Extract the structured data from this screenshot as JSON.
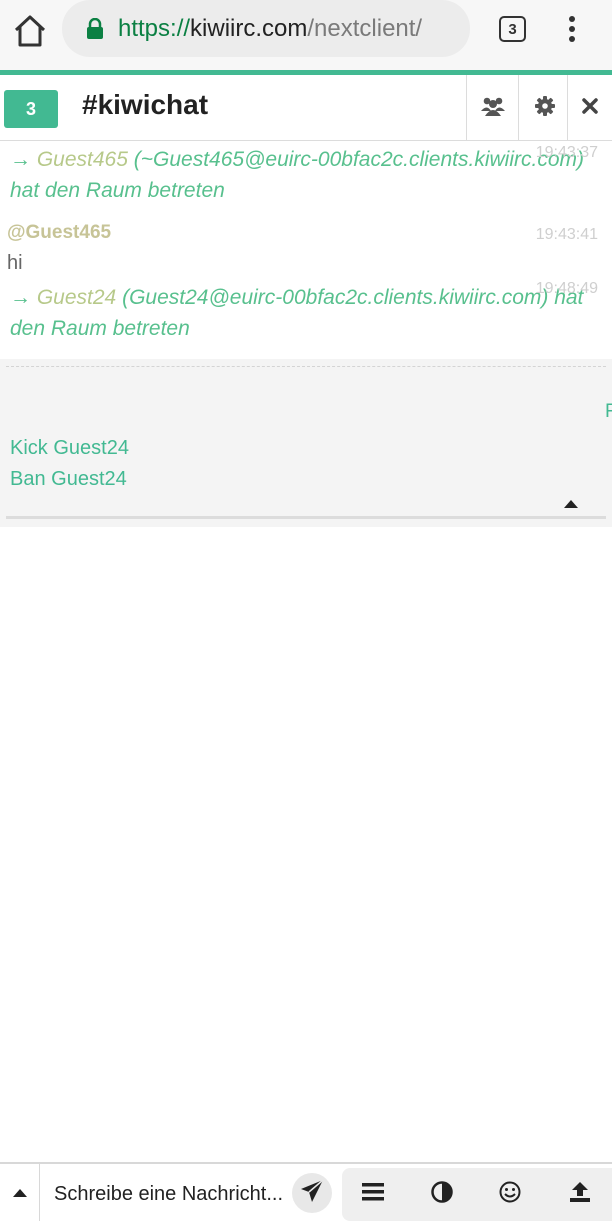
{
  "browser": {
    "url_scheme": "https://",
    "url_host": "kiwiirc.com",
    "url_path": "/nextclient/",
    "tab_count": "3"
  },
  "header": {
    "badge": "3",
    "channel": "#kiwichat"
  },
  "messages": [
    {
      "type": "join",
      "nick": "Guest465",
      "text": "(~Guest465@euirc-00bfac2c.clients.kiwiirc.com) hat den Raum betreten",
      "time": "19:43:37"
    },
    {
      "type": "message",
      "nick": "@Guest465",
      "text": "hi",
      "time": "19:43:41"
    },
    {
      "type": "join",
      "nick": "Guest24",
      "text": "(Guest24@euirc-00bfac2c.clients.kiwiirc.com) hat den Raum betreten",
      "time": "19:48:49"
    }
  ],
  "user_box": {
    "sliver": "F",
    "kick": "Kick Guest24",
    "ban": "Ban Guest24"
  },
  "input": {
    "placeholder": "Schreibe eine Nachricht..."
  },
  "colors": {
    "accent": "#42b992",
    "join_text": "#58c08e",
    "url_scheme": "#0b8043"
  }
}
